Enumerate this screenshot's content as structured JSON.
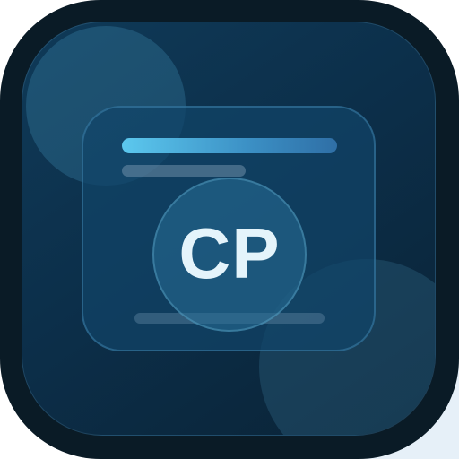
{
  "icon": {
    "monogram": "CP",
    "colors": {
      "outer": "#0a1b26",
      "inner": "#0c2f4a",
      "accent": "#5cc8ee",
      "text": "#e4f4fb"
    }
  }
}
